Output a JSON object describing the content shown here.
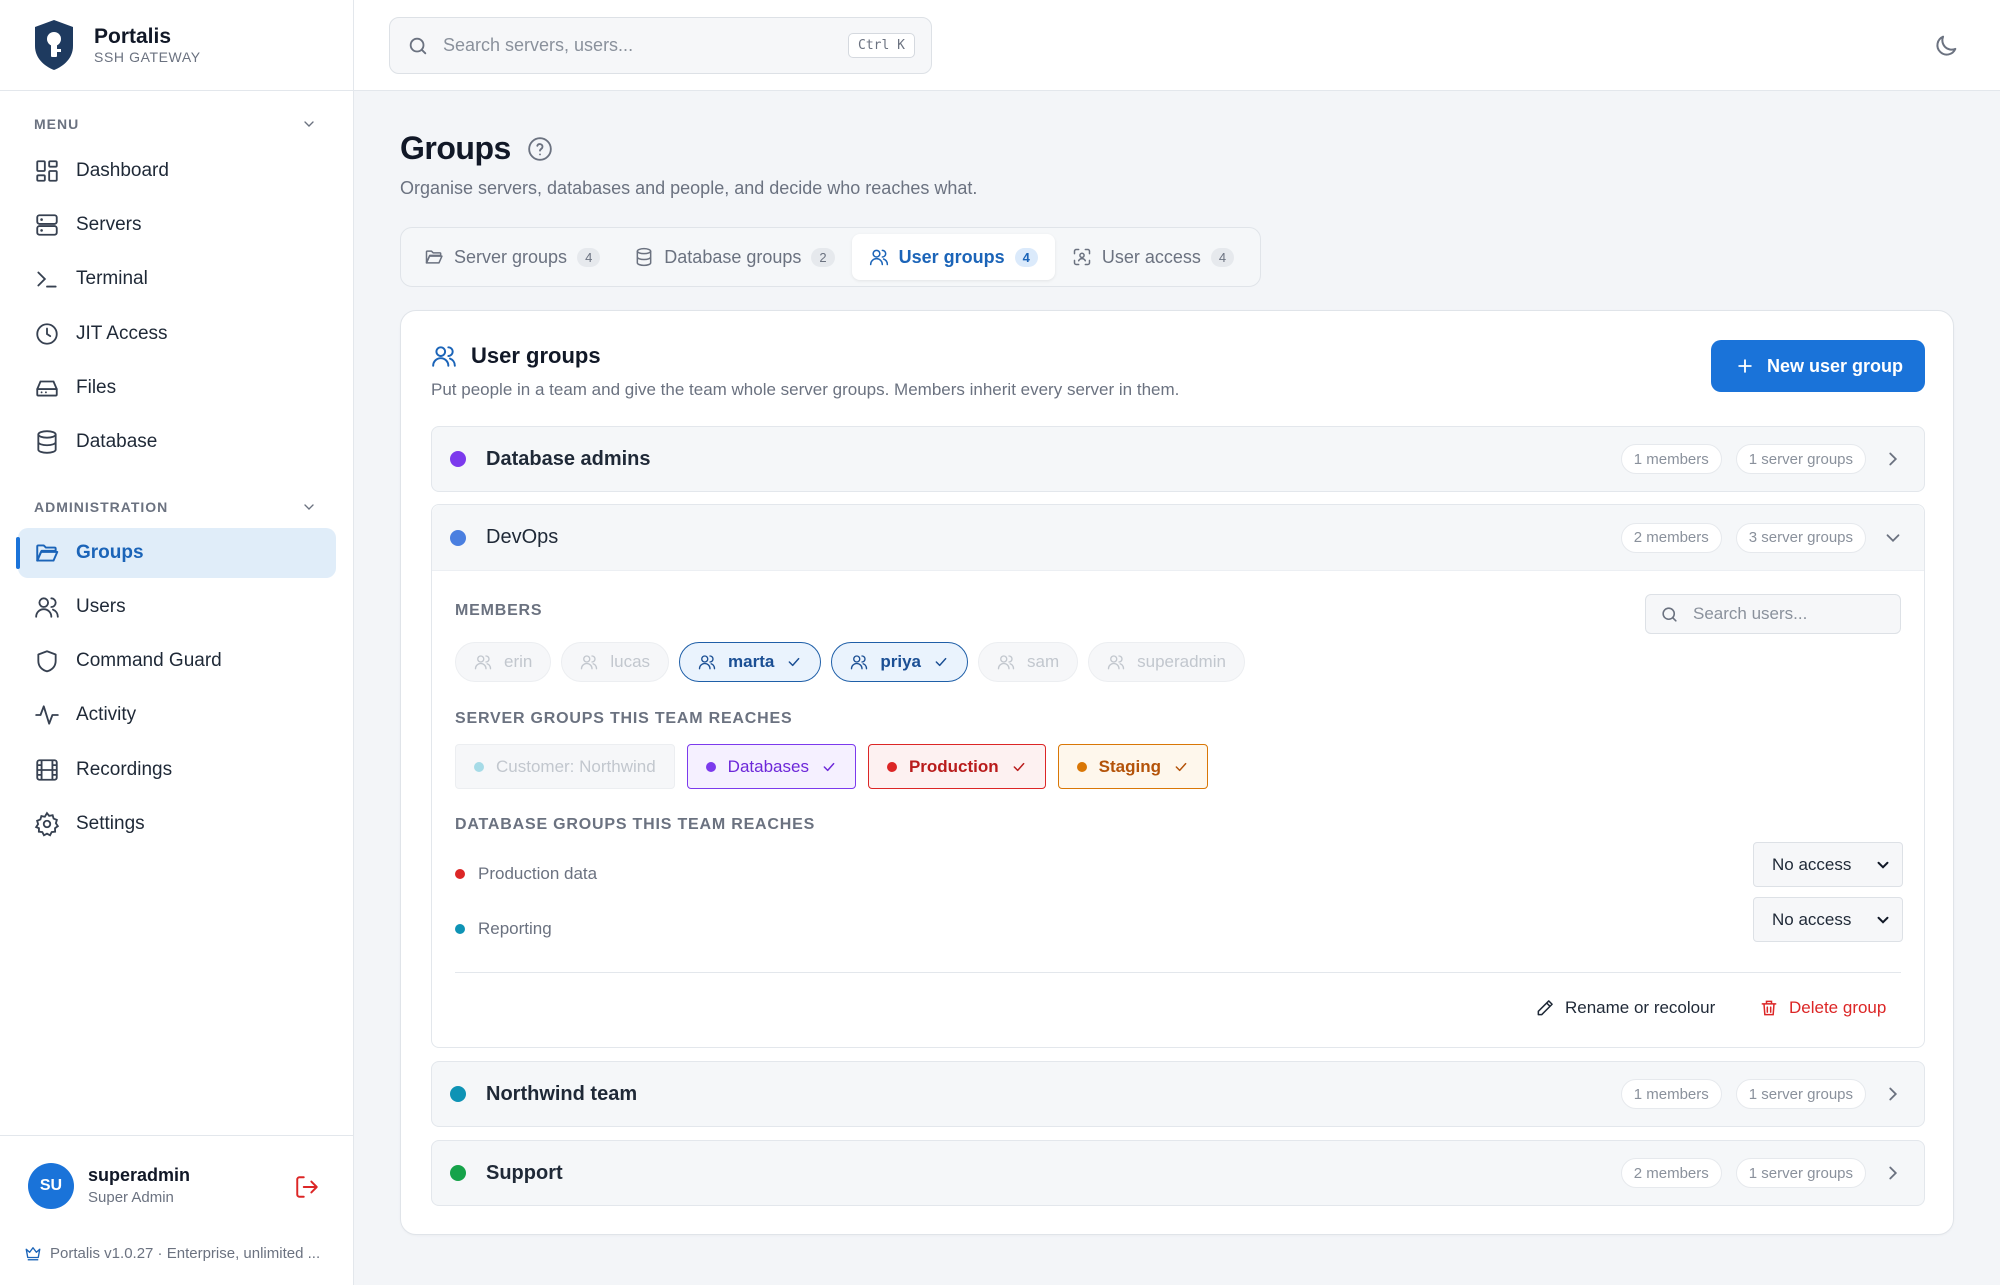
{
  "brand": {
    "name": "Portalis",
    "subtitle": "SSH GATEWAY"
  },
  "sidebar": {
    "menu_heading": "MENU",
    "menu_items": [
      {
        "label": "Dashboard",
        "icon": "dashboard-icon"
      },
      {
        "label": "Servers",
        "icon": "server-icon"
      },
      {
        "label": "Terminal",
        "icon": "terminal-icon"
      },
      {
        "label": "JIT Access",
        "icon": "clock-icon"
      },
      {
        "label": "Files",
        "icon": "drive-icon"
      },
      {
        "label": "Database",
        "icon": "database-icon"
      }
    ],
    "admin_heading": "ADMINISTRATION",
    "admin_items": [
      {
        "label": "Groups",
        "icon": "folder-icon",
        "active": true
      },
      {
        "label": "Users",
        "icon": "users-icon"
      },
      {
        "label": "Command Guard",
        "icon": "shield-icon"
      },
      {
        "label": "Activity",
        "icon": "activity-icon"
      },
      {
        "label": "Recordings",
        "icon": "film-icon"
      },
      {
        "label": "Settings",
        "icon": "gear-icon"
      }
    ],
    "user": {
      "initials": "SU",
      "name": "superadmin",
      "role": "Super Admin"
    },
    "version": "Portalis v1.0.27 · Enterprise, unlimited ..."
  },
  "topbar": {
    "search_placeholder": "Search servers, users...",
    "shortcut": "Ctrl K"
  },
  "page": {
    "title": "Groups",
    "subtitle": "Organise servers, databases and people, and decide who reaches what.",
    "tabs": [
      {
        "label": "Server groups",
        "count": "4",
        "icon": "folder-icon"
      },
      {
        "label": "Database groups",
        "count": "2",
        "icon": "database-icon"
      },
      {
        "label": "User groups",
        "count": "4",
        "icon": "users-icon",
        "active": true
      },
      {
        "label": "User access",
        "count": "4",
        "icon": "scan-user-icon"
      }
    ]
  },
  "card": {
    "title": "User groups",
    "subtitle": "Put people in a team and give the team whole server groups. Members inherit every server in them.",
    "new_button": "New user group",
    "groups": [
      {
        "name": "Database admins",
        "color": "#7c3aed",
        "members": "1 members",
        "server_groups": "1 server groups"
      },
      {
        "name": "DevOps",
        "color": "#4a7fe0",
        "members": "2 members",
        "server_groups": "3 server groups"
      },
      {
        "name": "Northwind team",
        "color": "#0e93b5",
        "members": "1 members",
        "server_groups": "1 server groups"
      },
      {
        "name": "Support",
        "color": "#16a34a",
        "members": "2 members",
        "server_groups": "1 server groups"
      }
    ],
    "devops": {
      "members_label": "MEMBERS",
      "search_placeholder": "Search users...",
      "members": [
        {
          "name": "erin",
          "selected": false
        },
        {
          "name": "lucas",
          "selected": false
        },
        {
          "name": "marta",
          "selected": true
        },
        {
          "name": "priya",
          "selected": true
        },
        {
          "name": "sam",
          "selected": false
        },
        {
          "name": "superadmin",
          "selected": false
        }
      ],
      "server_groups_label": "SERVER GROUPS THIS TEAM REACHES",
      "server_groups": [
        {
          "name": "Customer: Northwind",
          "selected": false,
          "color": "#67c6dc"
        },
        {
          "name": "Databases",
          "selected": true,
          "color": "#7c3aed"
        },
        {
          "name": "Production",
          "selected": true,
          "color": "#dc2626"
        },
        {
          "name": "Staging",
          "selected": true,
          "color": "#d97706"
        }
      ],
      "db_groups_label": "DATABASE GROUPS THIS TEAM REACHES",
      "db_groups": [
        {
          "name": "Production data",
          "access": "No access",
          "color": "#dc2626"
        },
        {
          "name": "Reporting",
          "access": "No access",
          "color": "#0e93b5"
        }
      ],
      "rename_label": "Rename or recolour",
      "delete_label": "Delete group"
    }
  }
}
